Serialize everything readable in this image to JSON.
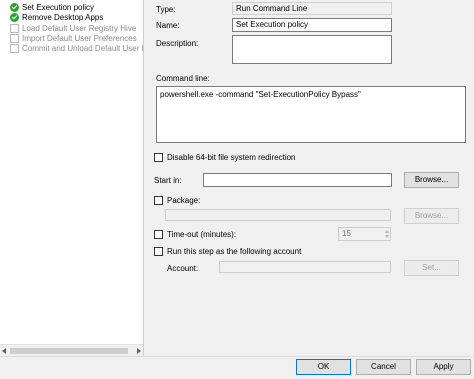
{
  "tree": {
    "items": [
      {
        "label": "Set Execution policy",
        "icon": "green-check-icon"
      },
      {
        "label": "Remove Desktop Apps",
        "icon": "green-check-icon"
      },
      {
        "label": "Load Default User Registry Hive",
        "icon": "document-icon"
      },
      {
        "label": "Import Default User Preferences",
        "icon": "document-icon"
      },
      {
        "label": "Commit and Unload Default User Reg",
        "icon": "document-icon"
      }
    ]
  },
  "form": {
    "type_label": "Type:",
    "type_value": "Run Command Line",
    "name_label": "Name:",
    "name_value": "Set Execution policy",
    "description_label": "Description:",
    "description_value": "",
    "command_line_label": "Command line:",
    "command_line_value": "powershell.exe -command \"Set-ExecutionPolicy Bypass\"",
    "disable_redirection_label": "Disable 64-bit file system redirection",
    "start_in_label": "Start in:",
    "start_in_value": "",
    "browse_label": "Browse...",
    "package_label": "Package:",
    "package_value": "",
    "package_browse_label": "Browse...",
    "timeout_label": "Time-out (minutes):",
    "timeout_value": "15",
    "run_as_label": "Run this step as the following account",
    "account_label": "Account:",
    "account_value": "",
    "set_label": "Set..."
  },
  "footer": {
    "ok_label": "OK",
    "cancel_label": "Cancel",
    "apply_label": "Apply"
  }
}
